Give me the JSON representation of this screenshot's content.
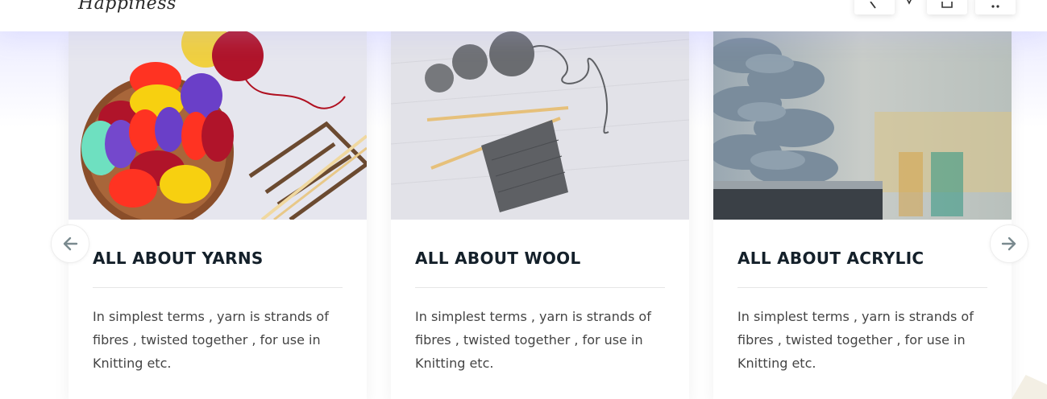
{
  "header": {
    "logo_text": "Happiness",
    "icons": [
      "search-icon",
      "account-icon",
      "cart-icon"
    ]
  },
  "carousel": {
    "prev_icon": "arrow-left-icon",
    "next_icon": "arrow-right-icon",
    "cards": [
      {
        "title": "ALL ABOUT YARNS",
        "text": "In simplest terms , yarn is strands of fibres , twisted together , for use in Knitting etc.",
        "image": "colorful-yarn-basket"
      },
      {
        "title": "ALL ABOUT WOOL",
        "text": "In simplest terms , yarn is strands of fibres , twisted together , for use in Knitting etc.",
        "image": "grey-wool-knitting"
      },
      {
        "title": "ALL ABOUT ACRYLIC",
        "text": "In simplest terms , yarn is strands of fibres , twisted together , for use in Knitting etc.",
        "image": "acrylic-roving"
      }
    ]
  },
  "colors": {
    "heading": "#14202a",
    "body_text": "#444444",
    "arrow": "#7a8a8f"
  }
}
